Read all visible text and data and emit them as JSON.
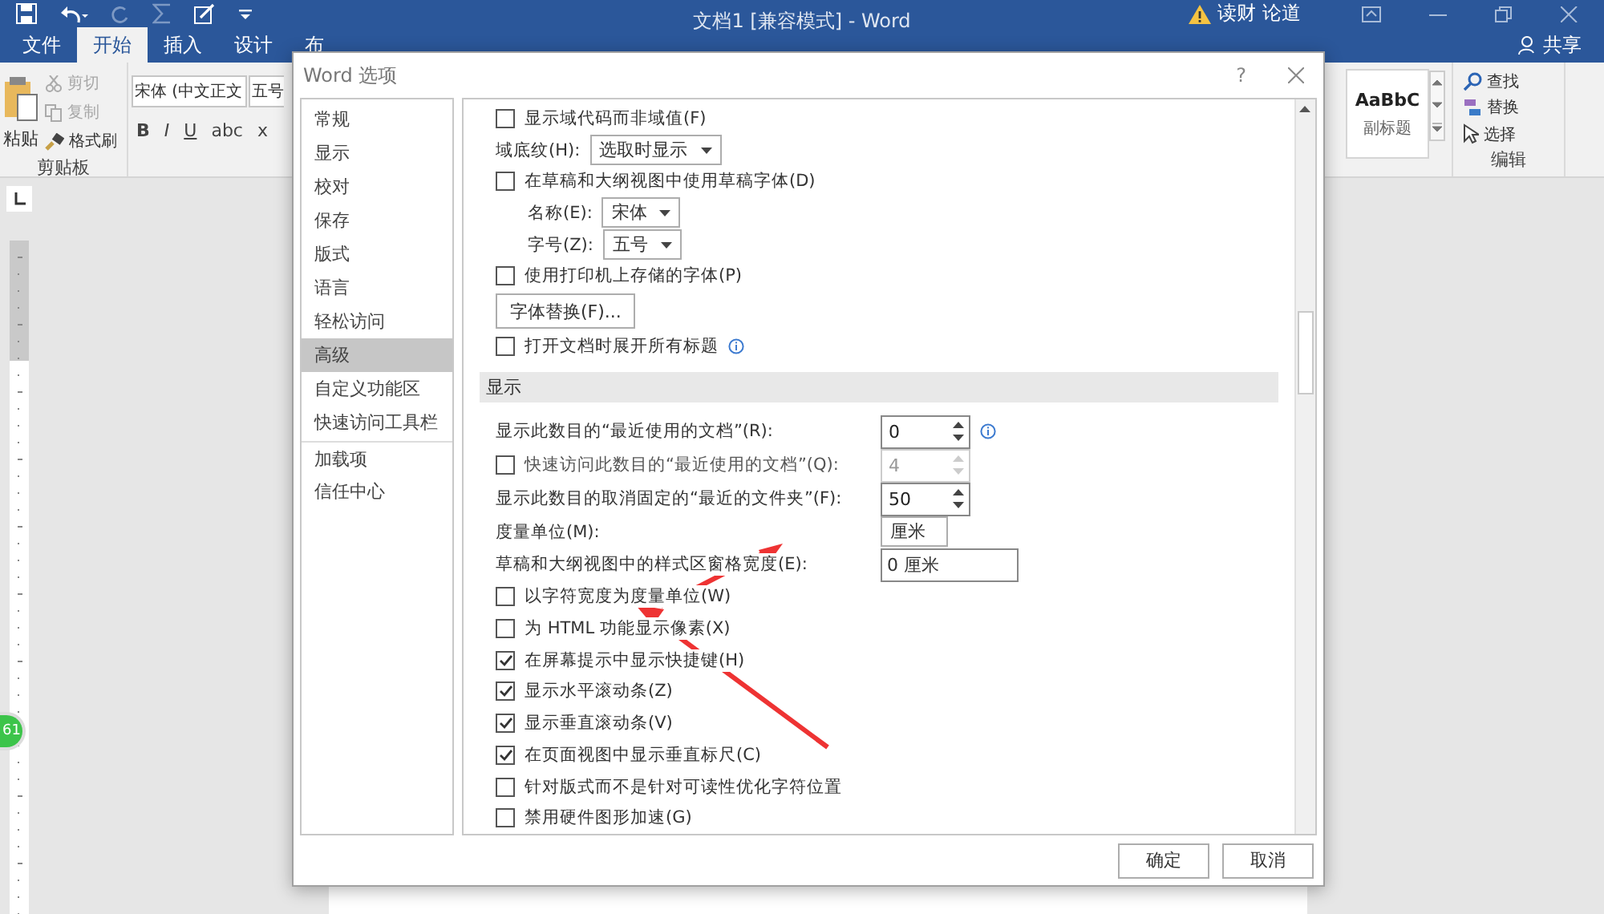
{
  "title_bar": {
    "title": "文档1 [兼容模式] - Word",
    "account": "读财 论道"
  },
  "ribbon_tabs": [
    {
      "label": "文件",
      "selected": false
    },
    {
      "label": "开始",
      "selected": true
    },
    {
      "label": "插入",
      "selected": false
    },
    {
      "label": "设计",
      "selected": false
    },
    {
      "label": "布",
      "selected": false
    }
  ],
  "share": "共享",
  "clipboard": {
    "paste": "粘贴",
    "items": [
      {
        "kind": "cut",
        "label": "剪切",
        "disabled": true
      },
      {
        "kind": "copy",
        "label": "复制",
        "disabled": true
      },
      {
        "kind": "painter",
        "label": "格式刷",
        "disabled": false
      }
    ],
    "group": "剪贴板"
  },
  "font": {
    "name": "宋体 (中文正文",
    "size": "五号",
    "buttons": [
      "B",
      "I",
      "U",
      "abc",
      "x"
    ]
  },
  "styles": {
    "preview": "AaBbC",
    "name": "副标题"
  },
  "editing": {
    "items": [
      {
        "kind": "find",
        "label": "查找"
      },
      {
        "kind": "replace",
        "label": "替换"
      },
      {
        "kind": "select",
        "label": "选择"
      }
    ],
    "group": "编辑"
  },
  "badge": "61",
  "dialog": {
    "title": "Word 选项",
    "help": "?",
    "sidebar": [
      {
        "label": "常规",
        "selected": false
      },
      {
        "label": "显示",
        "selected": false
      },
      {
        "label": "校对",
        "selected": false
      },
      {
        "label": "保存",
        "selected": false
      },
      {
        "label": "版式",
        "selected": false
      },
      {
        "label": "语言",
        "selected": false
      },
      {
        "label": "轻松访问",
        "selected": false
      },
      {
        "label": "高级",
        "selected": true
      },
      {
        "label": "自定义功能区",
        "selected": false
      },
      {
        "label": "快速访问工具栏",
        "selected": false
      },
      {
        "label": "加载项",
        "selected": false
      },
      {
        "label": "信任中心",
        "selected": false
      }
    ],
    "rows": [
      {
        "kind": "checkbox",
        "label": "显示域代码而非域值(F)",
        "checked": false
      },
      {
        "kind": "dropdown",
        "label": "域底纹(H):",
        "value": "选取时显示"
      },
      {
        "kind": "checkbox",
        "label": "在草稿和大纲视图中使用草稿字体(D)",
        "checked": false,
        "children": [
          {
            "kind": "dropdown",
            "label": "名称(E):",
            "value": "宋体"
          },
          {
            "kind": "dropdown",
            "label": "字号(Z):",
            "value": "五号"
          }
        ]
      },
      {
        "kind": "checkbox",
        "label": "使用打印机上存储的字体(P)",
        "checked": false
      },
      {
        "kind": "button",
        "label": "字体替换(F)..."
      },
      {
        "kind": "checkbox",
        "label": "打开文档时展开所有标题",
        "checked": false,
        "info": true
      },
      {
        "kind": "section",
        "label": "显示"
      },
      {
        "kind": "spinner",
        "label": "显示此数目的“最近使用的文档”(R):",
        "value": "0",
        "info": true
      },
      {
        "kind": "spinner",
        "label": "快速访问此数目的“最近使用的文档”(Q):",
        "value": "4",
        "checked": false,
        "disabled": true
      },
      {
        "kind": "spinner",
        "label": "显示此数目的取消固定的“最近的文件夹”(F):",
        "value": "50"
      },
      {
        "kind": "dropdown",
        "label": "度量单位(M):",
        "value": "厘米",
        "wide": true
      },
      {
        "kind": "text",
        "label": "草稿和大纲视图中的样式区窗格宽度(E):",
        "value": "0 厘米"
      },
      {
        "kind": "checkbox",
        "label": "以字符宽度为度量单位(W)",
        "checked": false
      },
      {
        "kind": "checkbox",
        "label": "为 HTML 功能显示像素(X)",
        "checked": false
      },
      {
        "kind": "checkbox",
        "label": "在屏幕提示中显示快捷键(H)",
        "checked": true
      },
      {
        "kind": "checkbox",
        "label": "显示水平滚动条(Z)",
        "checked": true
      },
      {
        "kind": "checkbox",
        "label": "显示垂直滚动条(V)",
        "checked": true
      },
      {
        "kind": "checkbox",
        "label": "在页面视图中显示垂直标尺(C)",
        "checked": true
      },
      {
        "kind": "checkbox",
        "label": "针对版式而不是针对可读性优化字符位置",
        "checked": false
      },
      {
        "kind": "checkbox",
        "label": "禁用硬件图形加速(G)",
        "checked": false
      }
    ],
    "buttons": [
      "确定",
      "取消"
    ]
  }
}
